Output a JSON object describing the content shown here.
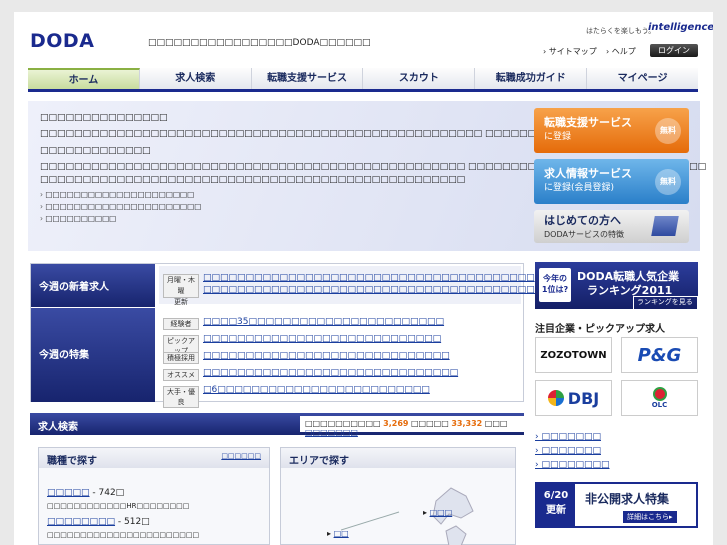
{
  "header": {
    "logo": "DODA",
    "tagline": "□□□□□□□□□□□□□□□□□DODA□□□□□□",
    "intel_tagline": "はたらくを楽しもう。",
    "intel_name": "intelligence",
    "sitemap": "› サイトマップ",
    "help": "› ヘルプ",
    "login": "ログイン"
  },
  "nav": [
    "ホーム",
    "求人検索",
    "転職支援サービス",
    "スカウト",
    "転職成功ガイド",
    "マイページ"
  ],
  "hero": {
    "line1": "□□□□□□□□□□□□□□□",
    "line2": "□□□□□□□□□□□□□□□□□□□□□□□□□□□□□□□□□□□□□□□□□□□□□□□□□□□□ □□□□□□□",
    "line3": "□□□□□□□□□□□□□",
    "line4": "□□□□□□□□□□□□□□□□□□□□□□□□□□□□□□□□□□□□□□□□□□□□□□□□□□ □□□□□□□□□□□□□□□□□□□□□□□□□□□□",
    "line5": "□□□□□□□□□□□□□□□□□□□□□□□□□□□□□□□□□□□□□□□□□□□□□□□□□□",
    "bullets": [
      "□□□□□□□□□□□□□□□□□□□□□",
      "□□□□□□□□□□□□□□□□□□□□□□",
      "□□□□□□□□□□"
    ],
    "promo_support_title": "転職支援サービス",
    "promo_support_sub": "に登録",
    "promo_jobinfo_title": "求人情報サービス",
    "promo_jobinfo_sub": "に登録(会員登録)",
    "free": "無料",
    "first_time_title": "はじめての方へ",
    "first_time_sub": "DODAサービスの特徴"
  },
  "weekly": {
    "new_label": "今週の新着求人",
    "new_tag_line1": "月曜・木曜",
    "new_tag_line2": "更新",
    "new_links": [
      "□□□□□□□□□□□□□□□□□□□□□□□□□□□□□□□□□□□□□□□",
      "□□□□□□□□□□□□□□□□□□□□□□□□□□□□□□□□□□□□□□□□…□"
    ],
    "feature_label": "今週の特集",
    "features": [
      {
        "tag": "経験者",
        "text": "□□□□35□□□□□□□□□□□□□□□□□□□□□□□"
      },
      {
        "tag": "ピックアップ",
        "text": "□□□□□□□□□□□□□□□□□□□□□□□□□□□□"
      },
      {
        "tag": "積極採用",
        "text": "□□□□□□□□□□□□□□□□□□□□□□□□□□□□□"
      },
      {
        "tag": "オススメ",
        "text": "□□□□□□□□□□□□□□□□□□□□□□□□□□□□□□"
      },
      {
        "tag": "大手・優良",
        "text": "□6□□□□□□□□□□□□□□□□□□□□□□□□□"
      }
    ]
  },
  "job_search": {
    "title": "求人検索",
    "count_prefix": "□□□□□□□□□□",
    "count1": "3,269",
    "count_mid": "□□□□□",
    "count2": "33,332",
    "count_suffix": "□□□",
    "count_link": "□□□□□□□",
    "by_job": "職種で探す",
    "by_job_link": "□□□□□□",
    "job_items": [
      {
        "name": "□□□□□",
        "count": " - 742□",
        "desc": "□□□□□□□□□□□□HR□□□□□□□□"
      },
      {
        "name": "□□□□□□□□",
        "count": " - 512□",
        "desc": "□□□□□□□□□□□□□□□□□□□□□□□"
      }
    ],
    "by_area": "エリアで探す",
    "area_hokkaido": "□□□",
    "area_tohoku": "□□"
  },
  "right": {
    "banner_badge_line1": "今年の",
    "banner_badge_line2": "1位は?",
    "banner_title": "DODA転職人気企業",
    "banner_sub": "ランキング2011",
    "banner_btn": "ランキングを見る▸",
    "pickup_title": "注目企業・ピックアップ求人",
    "logos": [
      "ZOZOTOWN",
      "P&G",
      "DBJ",
      "OLC"
    ],
    "side_links": [
      "› □□□□□□□",
      "› □□□□□□□",
      "› □□□□□□□□"
    ],
    "secret_date_line1": "6/20",
    "secret_date_line2": "更新",
    "secret_title": "非公開求人特集",
    "secret_btn": "詳細はこちら▸"
  }
}
